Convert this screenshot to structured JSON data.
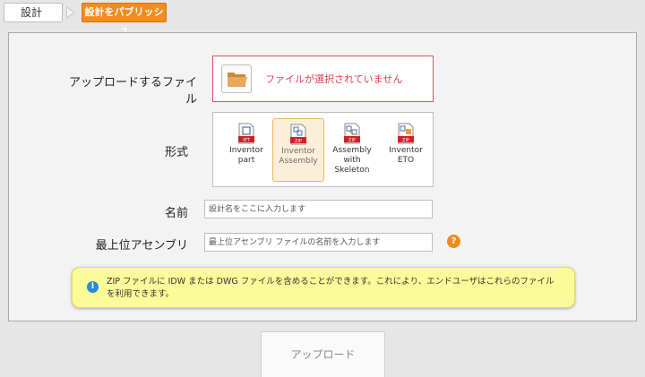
{
  "breadcrumb": {
    "step1": "設計",
    "step2": "設計をパブリッシュ"
  },
  "form": {
    "upload_label": "アップロードするファイル",
    "file_status": "ファイルが選択されていません",
    "format_label": "形式",
    "formats": [
      {
        "label": "Inventor part",
        "badge": "IPT",
        "selected": false
      },
      {
        "label": "Inventor Assembly",
        "badge": "ZIP",
        "selected": true
      },
      {
        "label": "Assembly with Skeleton",
        "badge": "ZIP",
        "selected": false
      },
      {
        "label": "Inventor ETO",
        "badge": "ZIP",
        "selected": false
      }
    ],
    "name_label": "名前",
    "name_placeholder": "設計名をここに入力します",
    "top_assembly_label": "最上位アセンブリ",
    "top_assembly_placeholder": "最上位アセンブリ ファイルの名前を入力します",
    "help_glyph": "?",
    "info_glyph": "i",
    "info_text": "ZIP ファイルに IDW または DWG ファイルを含めることができます。これにより、エンドユーザはこれらのファイルを利用できます。"
  },
  "actions": {
    "upload_button": "アップロード"
  },
  "colors": {
    "accent_orange": "#f28c1e",
    "error_red": "#e04050",
    "selected_fill": "#fcefd9",
    "info_yellow": "#fbfb9a"
  }
}
